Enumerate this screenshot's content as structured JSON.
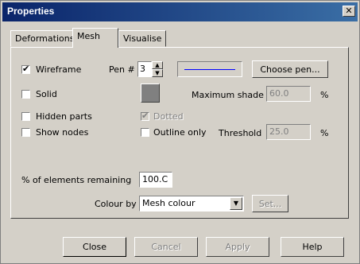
{
  "window": {
    "title": "Properties",
    "close_glyph": "✕"
  },
  "tabs": [
    {
      "label": "Deformations"
    },
    {
      "label": "Mesh"
    },
    {
      "label": "Visualise"
    }
  ],
  "mesh": {
    "wireframe": {
      "label": "Wireframe",
      "checked": true
    },
    "pen_label": "Pen #",
    "pen_value": "3",
    "choose_pen_label": "Choose pen...",
    "pen_color": "#0000ff",
    "solid": {
      "label": "Solid",
      "checked": false
    },
    "shade_color": "#808080",
    "max_shade_label": "Maximum shade",
    "max_shade_value": "60.0",
    "max_shade_unit": "%",
    "hidden_parts": {
      "label": "Hidden parts",
      "checked": false
    },
    "dotted": {
      "label": "Dotted",
      "checked": true,
      "disabled": true
    },
    "show_nodes": {
      "label": "Show nodes",
      "checked": false
    },
    "outline_only": {
      "label": "Outline only",
      "checked": false
    },
    "threshold_label": "Threshold",
    "threshold_value": "25.0",
    "threshold_unit": "%",
    "elements_remaining_label": "% of elements remaining",
    "elements_remaining_value": "100.C",
    "colour_by_label": "Colour by",
    "colour_by_value": "Mesh colour",
    "set_label": "Set..."
  },
  "buttons": {
    "close": "Close",
    "cancel": "Cancel",
    "apply": "Apply",
    "help": "Help"
  }
}
